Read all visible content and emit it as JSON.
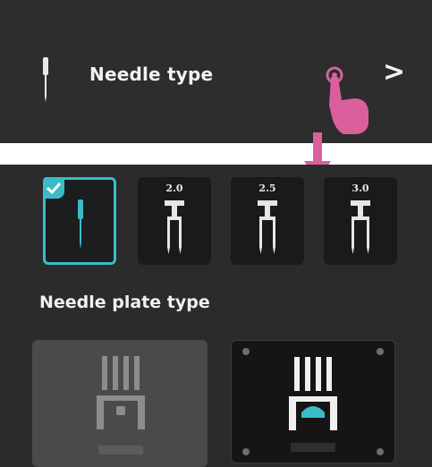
{
  "needle_setting": {
    "label": "Needle type",
    "chevron": ">"
  },
  "needle_options": [
    {
      "value": "",
      "selected": true,
      "icon": "single-needle-icon"
    },
    {
      "value": "2.0",
      "selected": false,
      "icon": "twin-needle-icon"
    },
    {
      "value": "2.5",
      "selected": false,
      "icon": "twin-needle-icon"
    },
    {
      "value": "3.0",
      "selected": false,
      "icon": "twin-needle-icon"
    }
  ],
  "needle_plate": {
    "label": "Needle plate type",
    "options": [
      {
        "state": "inactive",
        "icon": "straight-stitch-plate-icon"
      },
      {
        "state": "active",
        "icon": "zigzag-plate-icon"
      }
    ]
  },
  "colors": {
    "panel": "#2d2d2e",
    "accent_teal": "#39bcc8",
    "pointer_pink": "#d9609c",
    "text": "#f2f2f2"
  }
}
